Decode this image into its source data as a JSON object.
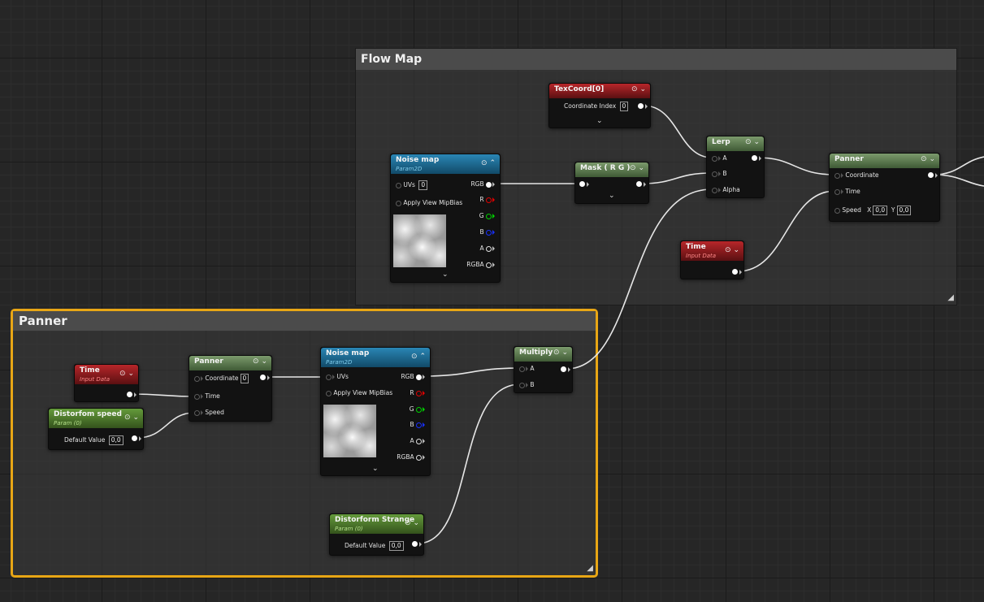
{
  "comments": {
    "flow_map": "Flow Map",
    "panner": "Panner"
  },
  "texcoord": {
    "title": "TexCoord[0]",
    "coordinate_index_label": "Coordinate Index",
    "coordinate_index_value": "0"
  },
  "noise_top": {
    "title": "Noise map",
    "subtitle": "Param2D",
    "uvs_label": "UVs",
    "uvs_value": "0",
    "apply_label": "Apply View MipBias",
    "rgb": "RGB",
    "r": "R",
    "g": "G",
    "b": "B",
    "a": "A",
    "rgba": "RGBA"
  },
  "mask": {
    "title": "Mask ( R G )"
  },
  "lerp": {
    "title": "Lerp",
    "a": "A",
    "b": "B",
    "alpha": "Alpha"
  },
  "panner_top": {
    "title": "Panner",
    "coordinate": "Coordinate",
    "time": "Time",
    "speed": "Speed",
    "x_label": "X",
    "x_value": "0,0",
    "y_label": "Y",
    "y_value": "0,0"
  },
  "time_top": {
    "title": "Time",
    "subtitle": "Input Data"
  },
  "time_bottom": {
    "title": "Time",
    "subtitle": "Input Data"
  },
  "distort_speed": {
    "title": "Distorfom speed",
    "subtitle": "Param (0)",
    "default_label": "Default Value",
    "default_value": "0,0"
  },
  "panner_bottom": {
    "title": "Panner",
    "coordinate": "Coordinate",
    "coordinate_value": "0",
    "time": "Time",
    "speed": "Speed"
  },
  "noise_bottom": {
    "title": "Noise map",
    "subtitle": "Param2D",
    "uvs_label": "UVs",
    "apply_label": "Apply View MipBias",
    "rgb": "RGB",
    "r": "R",
    "g": "G",
    "b": "B",
    "a": "A",
    "rgba": "RGBA"
  },
  "multiply": {
    "title": "Multiply",
    "a": "A",
    "b": "B"
  },
  "distort_strange": {
    "title": "Distorform Strange",
    "subtitle": "Param (0)",
    "default_label": "Default Value",
    "default_value": "0,0"
  },
  "icons": {
    "preview": "preview-toggle-icon",
    "collapse": "chevron-down-icon",
    "expand": "chevron-up-icon",
    "resize": "resize-grip-icon"
  },
  "colors": {
    "comment_selected": "#e8a615",
    "wire": "#e6e6e6",
    "param_header": "#2a86b5",
    "input_header": "#b8262a",
    "math_header": "#7b9a6c",
    "scalar_header": "#649a3b"
  }
}
